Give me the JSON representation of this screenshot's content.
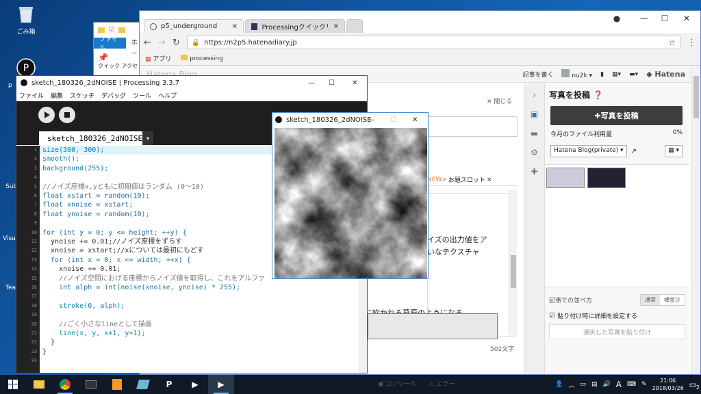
{
  "desktop": {
    "recycle_bin": "ごみ箱",
    "frag_p": "p",
    "frag_sub": "Sub",
    "frag_visual": "Visua",
    "frag_tea": "Tea"
  },
  "explorer": {
    "ribbon_file": "ファイル",
    "ribbon_home": "ホー",
    "quick_access": "クイック アクセ"
  },
  "chrome": {
    "tabs": [
      {
        "label": "p5_underground"
      },
      {
        "label": "Processingクイックリファレン"
      }
    ],
    "url": "https://n2p5.hatenadiary.jp",
    "bookmarks": [
      "アプリ",
      "processing"
    ],
    "hatena_top": {
      "blog_partial": "Hatena Blog",
      "write": "記事を書く",
      "user": "nu2k",
      "brand": "Hatena"
    },
    "editor": {
      "close": "閉じる",
      "new_tag": "NEW>",
      "odai": "お題スロット",
      "line1": "イズの出力値をア",
      "line2": "いなテクスチャ",
      "line3": "風に吹かれる草原のようになる。",
      "char_count": "502文字"
    },
    "side_panel": {
      "title": "写真を投稿",
      "post_button": "写真を投稿",
      "usage_label": "今月のファイル利用量",
      "usage_value": "0%",
      "album": "Hatena Blog(private)",
      "sort_label": "記事での並べ方",
      "sort_normal": "通常",
      "sort_horizontal": "横並び",
      "detail_label": "貼り付け時に詳細を設定する",
      "paste_button": "選択した写真を貼り付け"
    },
    "behind_bottom": {
      "console": "コンソール",
      "errors": "エラー"
    }
  },
  "processing": {
    "title": "sketch_180326_2dNOISE | Processing 3.3.7",
    "menus": [
      "ファイル",
      "編集",
      "スケッチ",
      "デバッグ",
      "ツール",
      "ヘルプ"
    ],
    "tab": "sketch_180326_2dNOISE",
    "lines": [
      "size(300, 300);",
      "smooth();",
      "background(255);",
      "",
      "//ノイズ座標x,yともに初期値はランダム (0～10)",
      "float xstart = random(10);",
      "float xnoise = xstart;",
      "float ynoise = random(10);",
      "",
      "for (int y = 0; y <= height; ++y) {",
      "  ynoise += 0.01;//ノイズ座標をずらす",
      "  xnoise = xstart;//xについては最初にもどす",
      "  for (int x = 0; x <= width; ++x) {",
      "    xnoise += 0.01;",
      "    //ノイズ空間における座標からノイズ値を取得し、これをアルファ",
      "    int alph = int(noise(xnoise, ynoise) * 255);",
      "",
      "    stroke(0, alph);",
      "",
      "    //ごく小さなlineとして描画",
      "    line(x, y, x+1, y+1);",
      "  }",
      "}",
      ""
    ]
  },
  "sketch": {
    "title": "sketch_180326_2dNOISE"
  },
  "taskbar": {
    "time": "21:06",
    "date": "2018/03/26",
    "ime": "A",
    "notifications": "2"
  },
  "colors": {
    "processing_dark": "#1e1e1e",
    "run_green": "#1e9e3a",
    "hatena_dark": "#3d3d3d",
    "taskbar": "#101a26"
  }
}
